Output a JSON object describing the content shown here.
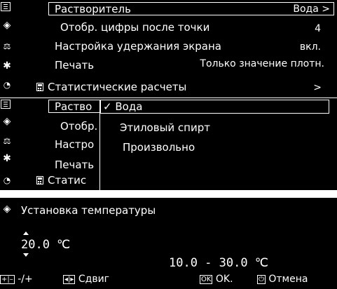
{
  "panel_top": {
    "rows": [
      {
        "label": "Растворитель",
        "value": "Вода >"
      },
      {
        "label": "Отобр. цифры после точки",
        "value": "4"
      },
      {
        "label": "Настройка удержания экрана",
        "value": "вкл."
      },
      {
        "label": "Печать",
        "value": "Только значение плотн."
      },
      {
        "label": "Статистические расчеты",
        "value": ">"
      }
    ],
    "icons": [
      "menu-icon",
      "diamond-icon",
      "balance-settings-icon",
      "gear-icon",
      "timer-icon"
    ]
  },
  "panel_middle": {
    "rows": [
      {
        "label": "Раство"
      },
      {
        "label": "Отобр."
      },
      {
        "label": "Настро"
      },
      {
        "label": "Печать"
      },
      {
        "label": "Статис"
      }
    ],
    "dropdown": {
      "check": "✓",
      "options": [
        "Вода",
        "Этиловый спирт",
        "Произвольно"
      ]
    }
  },
  "panel_bottom": {
    "title": "Установка температуры",
    "value": "20.0 ℃",
    "range": "10.0 - 30.0 ℃",
    "footer": {
      "plus_minus_key": "+|–",
      "plus_minus_label": "-/+",
      "shift_key": "◂|▸",
      "shift_label": "Сдвиг",
      "ok_key": "OK",
      "ok_label": "OK.",
      "cancel_key": "⏻",
      "cancel_label": "Отмена"
    }
  }
}
